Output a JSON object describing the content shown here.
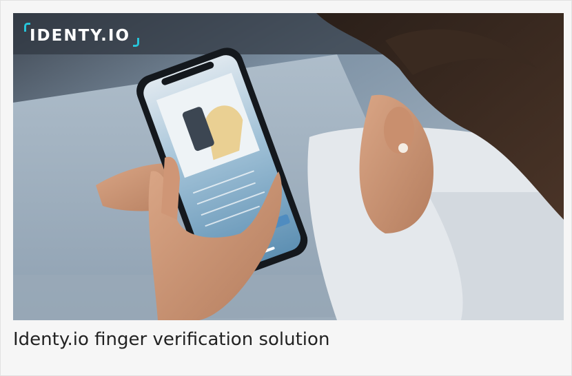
{
  "logo": {
    "text": "IDENTY.IO",
    "accent_color": "#27c4d9"
  },
  "caption": "Identy.io finger verification solution",
  "colors": {
    "background": "#f6f6f6",
    "caption_text": "#222222"
  }
}
